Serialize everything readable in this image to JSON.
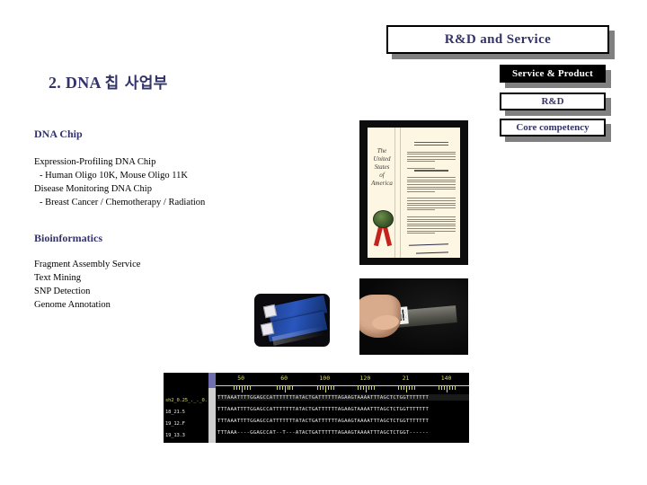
{
  "slide": {
    "banner_title": "R&D and Service",
    "title_number": "2.",
    "title_latin": "DNA",
    "title_korean": "칩 사업부",
    "title_full": "2. DNA 칩 사업부"
  },
  "category_boxes": [
    {
      "label": "Service & Product",
      "style": "black"
    },
    {
      "label": "R&D",
      "style": "white"
    },
    {
      "label": "Core competency",
      "style": "white"
    }
  ],
  "sections": [
    {
      "heading": "DNA Chip",
      "items": [
        {
          "text": "Expression-Profiling DNA Chip",
          "indent": false
        },
        {
          "text": "- Human Oligo 10K, Mouse Oligo 11K",
          "indent": true
        },
        {
          "text": "Disease Monitoring DNA Chip",
          "indent": false
        },
        {
          "text": "- Breast Cancer / Chemotherapy / Radiation",
          "indent": true
        }
      ]
    },
    {
      "heading": "Bioinformatics",
      "items": [
        {
          "text": "Fragment Assembly Service",
          "indent": false
        },
        {
          "text": "Text Mining",
          "indent": false
        },
        {
          "text": "SNP Detection",
          "indent": false
        },
        {
          "text": "Genome Annotation",
          "indent": false
        }
      ]
    }
  ],
  "images": {
    "certificate": {
      "name": "us-patent-certificate",
      "headline": "The United States of America",
      "line1": "The",
      "line2": "United",
      "line3": "States",
      "line4": "of",
      "line5": "America"
    },
    "slides_photo": {
      "name": "dna-chip-slides-photo"
    },
    "hand_photo": {
      "name": "hand-holding-dna-chip-photo"
    },
    "sequence_viewer": {
      "name": "sequence-alignment-viewer",
      "row_labels": [
        "sh2_0.25_._._0.",
        "18_21.5",
        "19_12.F",
        "19_13.3"
      ],
      "ruler_labels": [
        "50",
        "60",
        "100",
        "120",
        "21",
        "140"
      ],
      "sequences": [
        "TTTAAATTTTGGAGCCATTTTTTTATACTGATTTTTTAGAAGTAAAATTTAGCTCTGGTTTTTTT",
        "TTTAAATTTTGGAGCCATTTTTTTATACTGATTTTTTAGAAGTAAAATTTAGCTCTGGTTTTTTT",
        "TTTAAATTTTGGAGCCATTTTTTTATACTGATTTTTTAGAAGTAAAATTTAGCTCTGGTTTTTTT",
        "TTTAAA----GGAGCCAT--T---ATACTGATTTTTTAGAAGTAAAATTTAGCTCTGGT------"
      ]
    }
  },
  "colors": {
    "accent_text": "#33336b",
    "shadow": "#808080",
    "black_box": "#000000",
    "page_background": "#ffffff"
  }
}
